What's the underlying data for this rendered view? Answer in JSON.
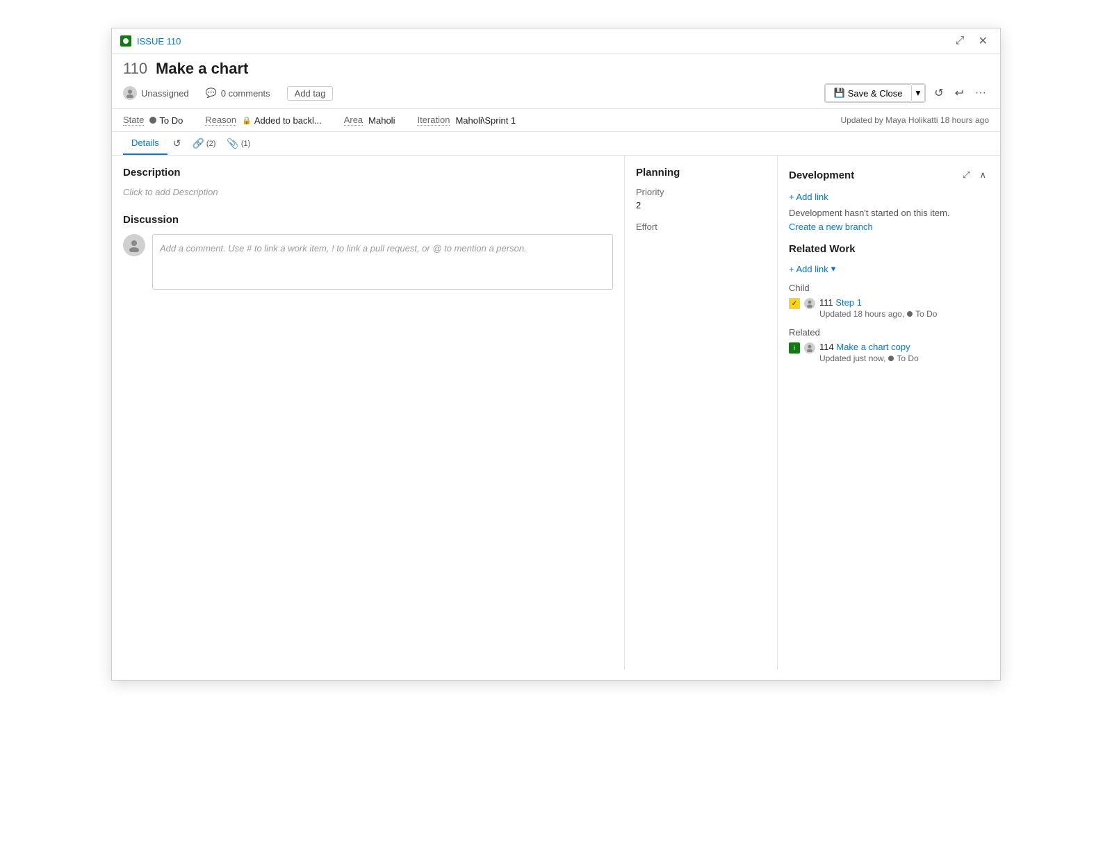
{
  "titlebar": {
    "issue_link": "ISSUE 110",
    "expand_label": "⤢",
    "close_label": "✕"
  },
  "header": {
    "issue_number": "110",
    "issue_title": "Make a chart",
    "assignee": "Unassigned",
    "comments_count": "0 comments",
    "add_tag_label": "Add tag",
    "save_close_label": "Save & Close",
    "updated_info": "Updated by Maya Holikatti 18 hours ago"
  },
  "fields": {
    "state_label": "State",
    "state_value": "To Do",
    "reason_label": "Reason",
    "reason_value": "Added to backl...",
    "area_label": "Area",
    "area_value": "Maholi",
    "iteration_label": "Iteration",
    "iteration_value": "Maholi\\Sprint 1"
  },
  "tabs": {
    "details_label": "Details",
    "history_label": "⟳",
    "links_label": "🔗",
    "links_count": "(2)",
    "attachments_label": "📎",
    "attachments_count": "(1)"
  },
  "description": {
    "title": "Description",
    "placeholder": "Click to add Description"
  },
  "discussion": {
    "title": "Discussion",
    "comment_placeholder": "Add a comment. Use # to link a work item, ! to link a pull request, or @ to mention a person."
  },
  "planning": {
    "title": "Planning",
    "priority_label": "Priority",
    "priority_value": "2",
    "effort_label": "Effort",
    "effort_value": ""
  },
  "development": {
    "title": "Development",
    "add_link_label": "+ Add link",
    "dev_info": "Development hasn't started on this item.",
    "create_branch_label": "Create a new branch"
  },
  "related_work": {
    "title": "Related Work",
    "add_link_label": "+ Add link",
    "child_label": "Child",
    "child_item_number": "111",
    "child_item_title": "Step 1",
    "child_item_meta": "Updated 18 hours ago,",
    "child_item_status": "To Do",
    "related_label": "Related",
    "related_item_number": "114",
    "related_item_title": "Make a chart copy",
    "related_item_meta": "Updated just now,",
    "related_item_status": "To Do"
  }
}
